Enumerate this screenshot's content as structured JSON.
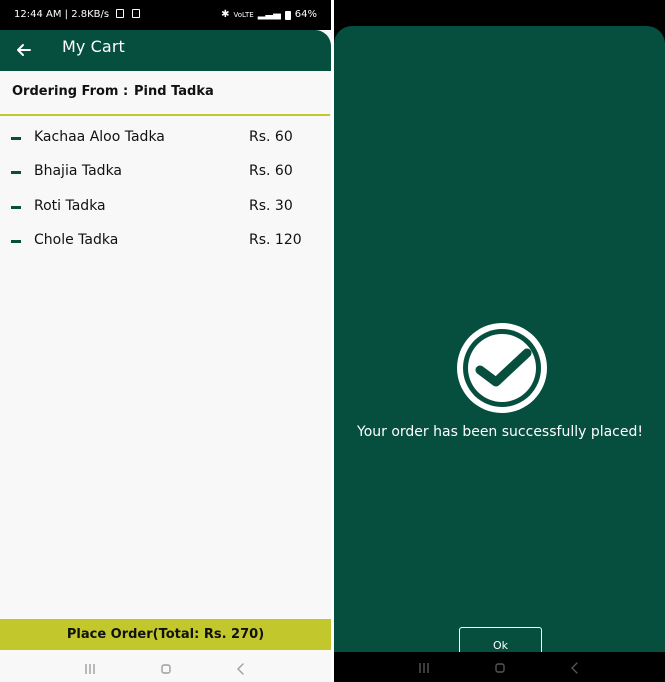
{
  "status_bar": {
    "time": "12:44 AM",
    "speed": "2.8KB/s",
    "network": "VoLTE",
    "battery": "64%"
  },
  "app_bar": {
    "title": "My Cart"
  },
  "cart": {
    "ordering_from_label": "Ordering From :",
    "restaurant": "Pind Tadka",
    "items": [
      {
        "name": "Kachaa Aloo Tadka",
        "price": "Rs. 60"
      },
      {
        "name": "Bhajia Tadka",
        "price": "Rs. 60"
      },
      {
        "name": "Roti Tadka",
        "price": "Rs. 30"
      },
      {
        "name": "Chole Tadka",
        "price": "Rs. 120"
      }
    ],
    "place_order_label": "Place Order(Total: Rs. 270)"
  },
  "success": {
    "message": "Your order has been successfully placed!",
    "ok_label": "Ok"
  },
  "colors": {
    "primary": "#064e3e",
    "accent": "#c2c82b",
    "screen_bg": "#f8f8f8",
    "panel_text": "#ffffff"
  },
  "icons": {
    "back": "arrow-left-icon",
    "success": "check-circle-icon",
    "nav_recent": "recent-apps-icon",
    "nav_home": "home-icon",
    "nav_back": "back-triangle-icon"
  }
}
